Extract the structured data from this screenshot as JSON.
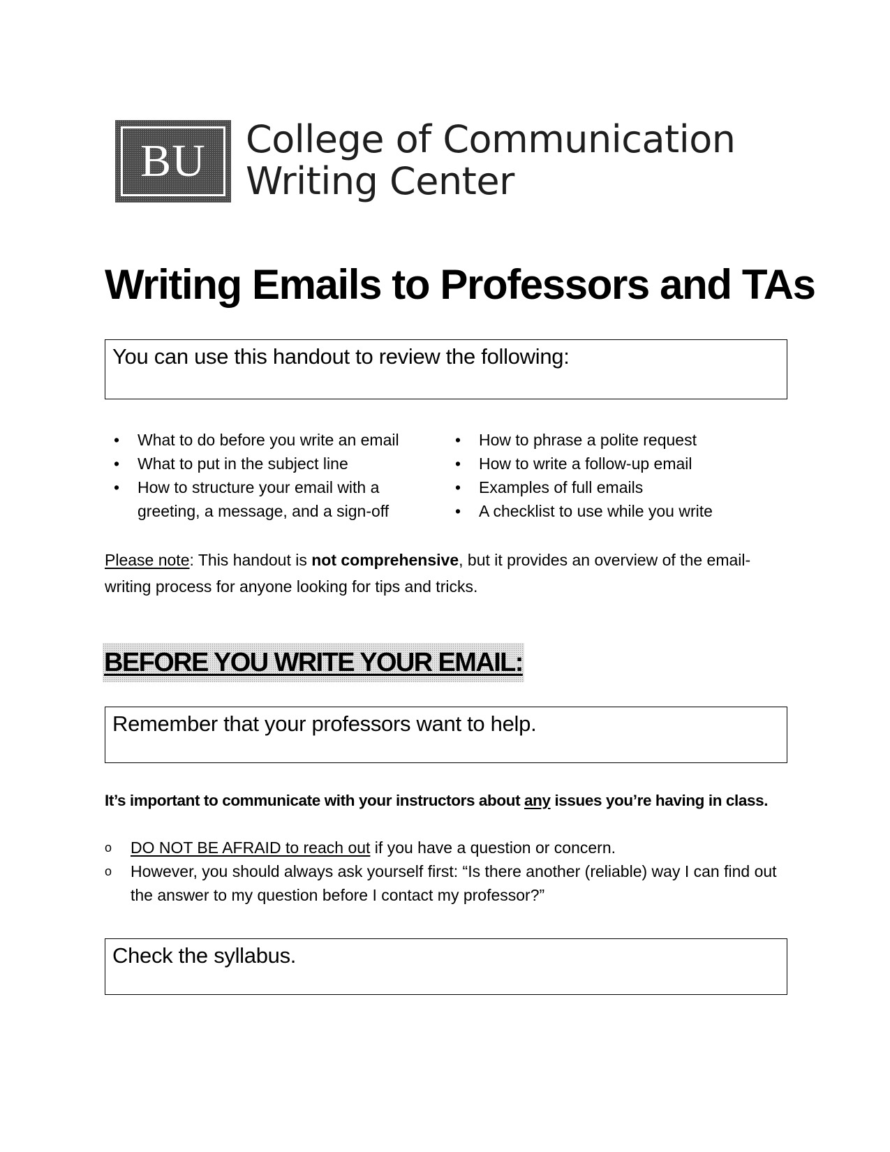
{
  "header": {
    "logo_mark": "BU",
    "org_line1": "College of Communication",
    "org_line2": "Writing Center"
  },
  "title": "Writing Emails to Professors and TAs",
  "review_box": {
    "label": "You can use this handout to review the following:"
  },
  "review_list": {
    "left": [
      "What to do before you write an email",
      "What to put in the subject line",
      "How to structure your email with a greeting, a message, and a sign-off"
    ],
    "right": [
      "How to phrase a polite request",
      "How to write a follow-up email",
      "Examples of full emails",
      "A checklist to use while you write"
    ],
    "bullet_glyph": "•"
  },
  "note": {
    "label": "Please note",
    "colon": ":",
    "text_before": " This handout is ",
    "emphasis": "not comprehensive",
    "text_after": ", but it provides an overview of the email-writing process for anyone looking for tips and tricks."
  },
  "section": {
    "heading": "BEFORE YOU WRITE YOUR EMAIL:"
  },
  "help_box": {
    "label": "Remember that your professors want to help."
  },
  "lead": {
    "before": "It’s important to communicate with your instructors about ",
    "underlined": "any",
    "after": " issues you’re having in class."
  },
  "sublist": {
    "marker": "o",
    "item1_underlined": "DO NOT BE AFRAID to reach out",
    "item1_rest": " if you have a question or concern.",
    "item2": "However, you should always ask yourself first: “Is there another (reliable) way I can find out the answer to my question before I contact my professor?”"
  },
  "syllabus_box": {
    "label": "Check the syllabus."
  }
}
